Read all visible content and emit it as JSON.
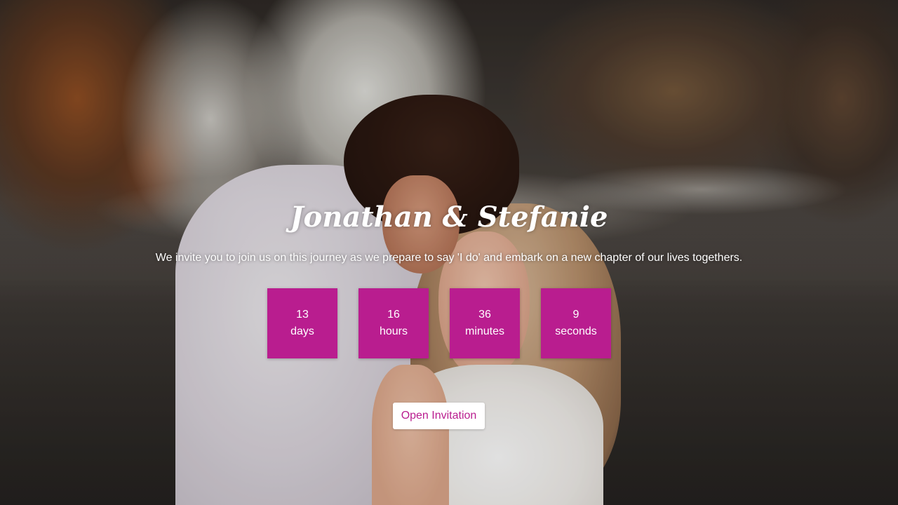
{
  "hero": {
    "title": "Jonathan & Stefanie",
    "tagline": "We invite you to join us on this journey as we prepare to say 'I do' and embark on a new chapter of our lives togethers."
  },
  "countdown": [
    {
      "value": "13",
      "unit": "days"
    },
    {
      "value": "16",
      "unit": "hours"
    },
    {
      "value": "36",
      "unit": "minutes"
    },
    {
      "value": "9",
      "unit": "seconds"
    }
  ],
  "open_button": {
    "label": "Open Invitation"
  },
  "colors": {
    "accent": "#b91d8f",
    "button_bg": "#ffffff",
    "text": "#ffffff"
  }
}
